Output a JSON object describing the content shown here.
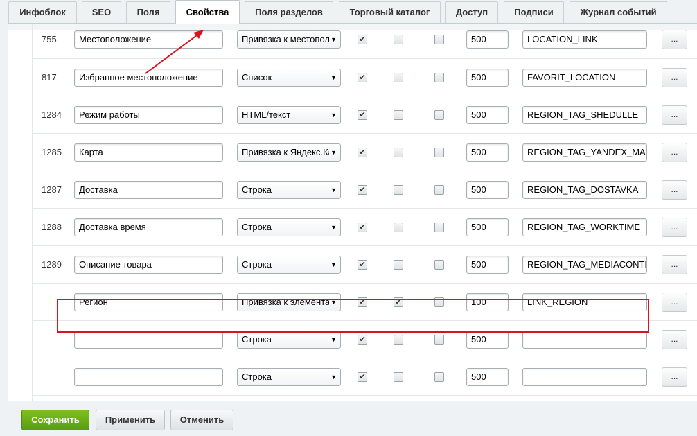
{
  "tabs": [
    {
      "label": "Инфоблок",
      "active": false
    },
    {
      "label": "SEO",
      "active": false
    },
    {
      "label": "Поля",
      "active": false
    },
    {
      "label": "Свойства",
      "active": true
    },
    {
      "label": "Поля разделов",
      "active": false
    },
    {
      "label": "Торговый каталог",
      "active": false
    },
    {
      "label": "Доступ",
      "active": false
    },
    {
      "label": "Подписи",
      "active": false
    },
    {
      "label": "Журнал событий",
      "active": false
    }
  ],
  "rows": [
    {
      "id": "755",
      "name": "Местоположение",
      "type": "Привязка к местоположению",
      "active": true,
      "multiple": false,
      "required": false,
      "sort": "500",
      "code": "LOCATION_LINK",
      "more_label": "..."
    },
    {
      "id": "817",
      "name": "Избранное местоположение",
      "type": "Список",
      "active": true,
      "multiple": false,
      "required": false,
      "sort": "500",
      "code": "FAVORIT_LOCATION",
      "more_label": "..."
    },
    {
      "id": "1284",
      "name": "Режим работы",
      "type": "HTML/текст",
      "active": true,
      "multiple": false,
      "required": false,
      "sort": "500",
      "code": "REGION_TAG_SHEDULLE",
      "more_label": "..."
    },
    {
      "id": "1285",
      "name": "Карта",
      "type": "Привязка к Яндекс.Карте",
      "active": true,
      "multiple": false,
      "required": false,
      "sort": "500",
      "code": "REGION_TAG_YANDEX_MAP",
      "more_label": "..."
    },
    {
      "id": "1287",
      "name": "Доставка",
      "type": "Строка",
      "active": true,
      "multiple": false,
      "required": false,
      "sort": "500",
      "code": "REGION_TAG_DOSTAVKA",
      "more_label": "..."
    },
    {
      "id": "1288",
      "name": "Доставка время",
      "type": "Строка",
      "active": true,
      "multiple": false,
      "required": false,
      "sort": "500",
      "code": "REGION_TAG_WORKTIME",
      "more_label": "..."
    },
    {
      "id": "1289",
      "name": "Описание товара",
      "type": "Строка",
      "active": true,
      "multiple": false,
      "required": false,
      "sort": "500",
      "code": "REGION_TAG_MEDIACONTENT",
      "more_label": "..."
    },
    {
      "id": "",
      "name": "Регион",
      "type": "Привязка к элементам",
      "active": true,
      "multiple": true,
      "required": false,
      "sort": "100",
      "code": "LINK_REGION",
      "more_label": "..."
    },
    {
      "id": "",
      "name": "",
      "type": "Строка",
      "active": true,
      "multiple": false,
      "required": false,
      "sort": "500",
      "code": "",
      "more_label": "..."
    },
    {
      "id": "",
      "name": "",
      "type": "Строка",
      "active": true,
      "multiple": false,
      "required": false,
      "sort": "500",
      "code": "",
      "more_label": "..."
    }
  ],
  "footer": {
    "save_label": "Сохранить",
    "apply_label": "Применить",
    "cancel_label": "Отменить"
  },
  "colors": {
    "highlight": "#d8151e",
    "save_button": "#6aad17"
  }
}
